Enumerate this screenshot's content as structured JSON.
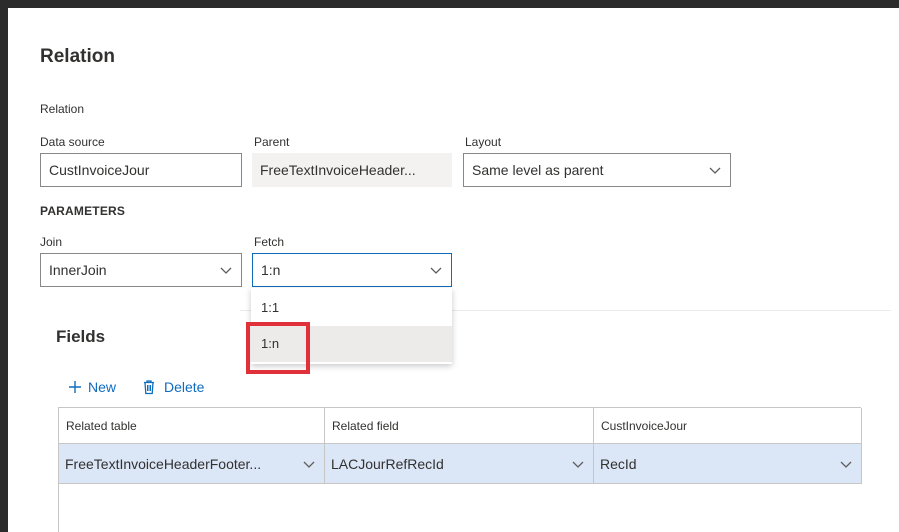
{
  "page": {
    "title": "Relation",
    "section_label": "Relation"
  },
  "relation": {
    "data_source_label": "Data source",
    "data_source_value": "CustInvoiceJour",
    "parent_label": "Parent",
    "parent_value": "FreeTextInvoiceHeader...",
    "layout_label": "Layout",
    "layout_value": "Same level as parent"
  },
  "parameters": {
    "heading": "PARAMETERS",
    "join_label": "Join",
    "join_value": "InnerJoin",
    "fetch_label": "Fetch",
    "fetch_value": "1:n",
    "fetch_options": [
      "1:1",
      "1:n"
    ]
  },
  "fields": {
    "heading": "Fields",
    "new_label": "New",
    "delete_label": "Delete",
    "columns": [
      "Related table",
      "Related field",
      "CustInvoiceJour"
    ],
    "rows": [
      [
        "FreeTextInvoiceHeaderFooter...",
        "LACJourRefRecId",
        "RecId"
      ]
    ]
  },
  "colors": {
    "accent": "#0f6cbd",
    "highlight_box": "#e0303a",
    "selected_row": "#dbe6f7"
  },
  "icons": [
    "chevron-down-icon",
    "add-icon",
    "trash-icon"
  ]
}
